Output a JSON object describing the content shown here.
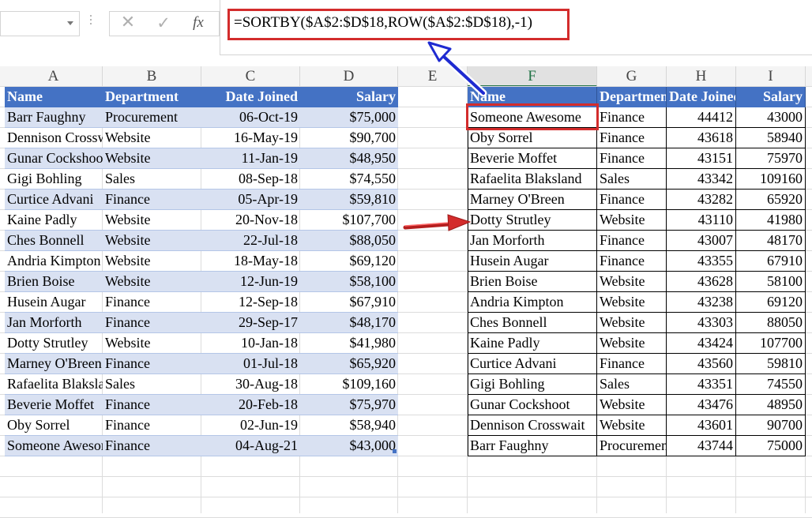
{
  "formula_bar": {
    "name_box_value": "",
    "formula": "=SORTBY($A$2:$D$18,ROW($A$2:$D$18),-1)",
    "cancel_icon": "x-icon",
    "enter_icon": "check-icon",
    "fx_label": "fx"
  },
  "column_headers": [
    "A",
    "B",
    "C",
    "D",
    "E",
    "F",
    "G",
    "H",
    "I"
  ],
  "source_table": {
    "headers": [
      "Name",
      "Department",
      "Date Joined",
      "Salary"
    ],
    "rows": [
      [
        "Barr Faughny",
        "Procurement",
        "06-Oct-19",
        "$75,000"
      ],
      [
        "Dennison Crosswait",
        "Website",
        "16-May-19",
        "$90,700"
      ],
      [
        "Gunar Cockshoot",
        "Website",
        "11-Jan-19",
        "$48,950"
      ],
      [
        "Gigi Bohling",
        "Sales",
        "08-Sep-18",
        "$74,550"
      ],
      [
        "Curtice Advani",
        "Finance",
        "05-Apr-19",
        "$59,810"
      ],
      [
        "Kaine Padly",
        "Website",
        "20-Nov-18",
        "$107,700"
      ],
      [
        "Ches Bonnell",
        "Website",
        "22-Jul-18",
        "$88,050"
      ],
      [
        "Andria Kimpton",
        "Website",
        "18-May-18",
        "$69,120"
      ],
      [
        "Brien Boise",
        "Website",
        "12-Jun-19",
        "$58,100"
      ],
      [
        "Husein Augar",
        "Finance",
        "12-Sep-18",
        "$67,910"
      ],
      [
        "Jan Morforth",
        "Finance",
        "29-Sep-17",
        "$48,170"
      ],
      [
        "Dotty Strutley",
        "Website",
        "10-Jan-18",
        "$41,980"
      ],
      [
        "Marney O'Breen",
        "Finance",
        "01-Jul-18",
        "$65,920"
      ],
      [
        "Rafaelita Blaksland",
        "Sales",
        "30-Aug-18",
        "$109,160"
      ],
      [
        "Beverie Moffet",
        "Finance",
        "20-Feb-18",
        "$75,970"
      ],
      [
        "Oby Sorrel",
        "Finance",
        "02-Jun-19",
        "$58,940"
      ],
      [
        "Someone Awesome",
        "Finance",
        "04-Aug-21",
        "$43,000"
      ]
    ]
  },
  "result_table": {
    "headers": [
      "Name",
      "Department",
      "Date Joined",
      "Salary"
    ],
    "rows": [
      [
        "Someone Awesome",
        "Finance",
        "44412",
        "43000"
      ],
      [
        "Oby Sorrel",
        "Finance",
        "43618",
        "58940"
      ],
      [
        "Beverie Moffet",
        "Finance",
        "43151",
        "75970"
      ],
      [
        "Rafaelita Blaksland",
        "Sales",
        "43342",
        "109160"
      ],
      [
        "Marney O'Breen",
        "Finance",
        "43282",
        "65920"
      ],
      [
        "Dotty Strutley",
        "Website",
        "43110",
        "41980"
      ],
      [
        "Jan Morforth",
        "Finance",
        "43007",
        "48170"
      ],
      [
        "Husein Augar",
        "Finance",
        "43355",
        "67910"
      ],
      [
        "Brien Boise",
        "Website",
        "43628",
        "58100"
      ],
      [
        "Andria Kimpton",
        "Website",
        "43238",
        "69120"
      ],
      [
        "Ches Bonnell",
        "Website",
        "43303",
        "88050"
      ],
      [
        "Kaine Padly",
        "Website",
        "43424",
        "107700"
      ],
      [
        "Curtice Advani",
        "Finance",
        "43560",
        "59810"
      ],
      [
        "Gigi Bohling",
        "Sales",
        "43351",
        "74550"
      ],
      [
        "Gunar Cockshoot",
        "Website",
        "43476",
        "48950"
      ],
      [
        "Dennison Crosswait",
        "Website",
        "43601",
        "90700"
      ],
      [
        "Barr Faughny",
        "Procurement",
        "43744",
        "75000"
      ]
    ]
  },
  "selected_column": "F",
  "colors": {
    "table_header": "#4472c4",
    "band": "#d9e1f2",
    "highlight": "#d32c2c",
    "arrow_blue": "#1f2bd1",
    "arrow_red": "#d32c2c",
    "selected_col_text": "#217346"
  }
}
